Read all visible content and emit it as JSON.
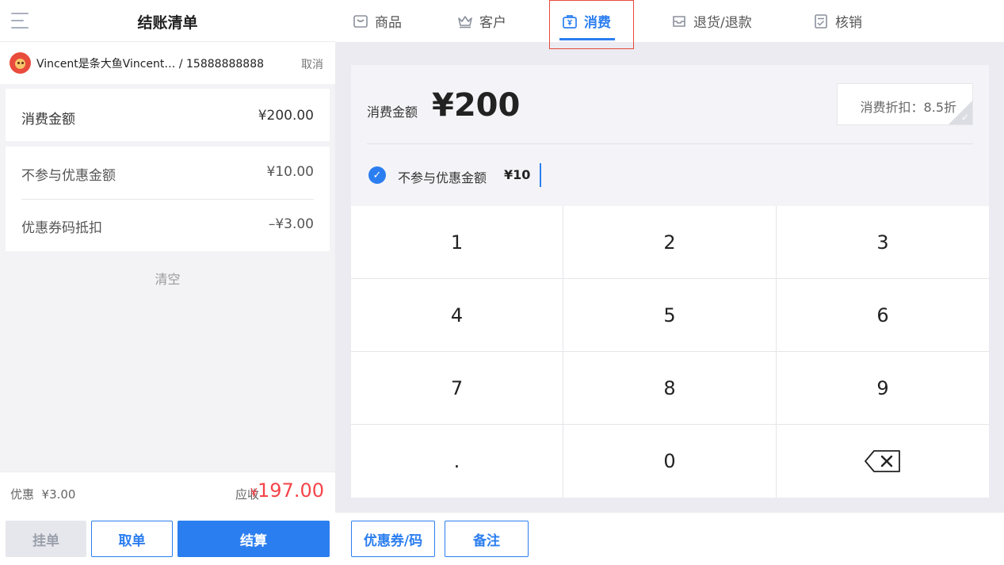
{
  "checkout": {
    "title": "结账清单",
    "customer": "Vincent是条大鱼Vincent… / 15888888888",
    "cancel_label": "取消",
    "amount_label": "消费金额",
    "amount_value": "¥200.00",
    "excluded_label": "不参与优惠金额",
    "excluded_value": "¥10.00",
    "coupon_label": "优惠券码抵扣",
    "coupon_value": "–¥3.00",
    "clear_label": "清空",
    "discount_summary": "优惠  ¥3.00",
    "due_label": "应收",
    "due_currency": "¥",
    "due_value": "197.00",
    "hold_label": "挂单",
    "take_label": "取单",
    "checkout_label": "结算"
  },
  "tabs": [
    {
      "label": "商品",
      "icon": "bag-icon"
    },
    {
      "label": "客户",
      "icon": "crown-icon"
    },
    {
      "label": "消费",
      "icon": "yen-bag-icon",
      "active": true
    },
    {
      "label": "退货/退款",
      "icon": "return-box-icon"
    },
    {
      "label": "核销",
      "icon": "checklist-icon"
    }
  ],
  "consume": {
    "amount_label": "消费金额",
    "amount_value": "¥200",
    "discount_badge": "消费折扣：8.5折",
    "exclude_label": "不参与优惠金额",
    "exclude_value": "¥10",
    "exclude_checked": true
  },
  "keypad": [
    "1",
    "2",
    "3",
    "4",
    "5",
    "6",
    "7",
    "8",
    "9",
    ".",
    "0"
  ],
  "actions": {
    "coupon_label": "优惠券/码",
    "note_label": "备注"
  },
  "colors": {
    "accent": "#2b7ef0",
    "due": "#f5454a",
    "highlight": "#e94b3c"
  }
}
